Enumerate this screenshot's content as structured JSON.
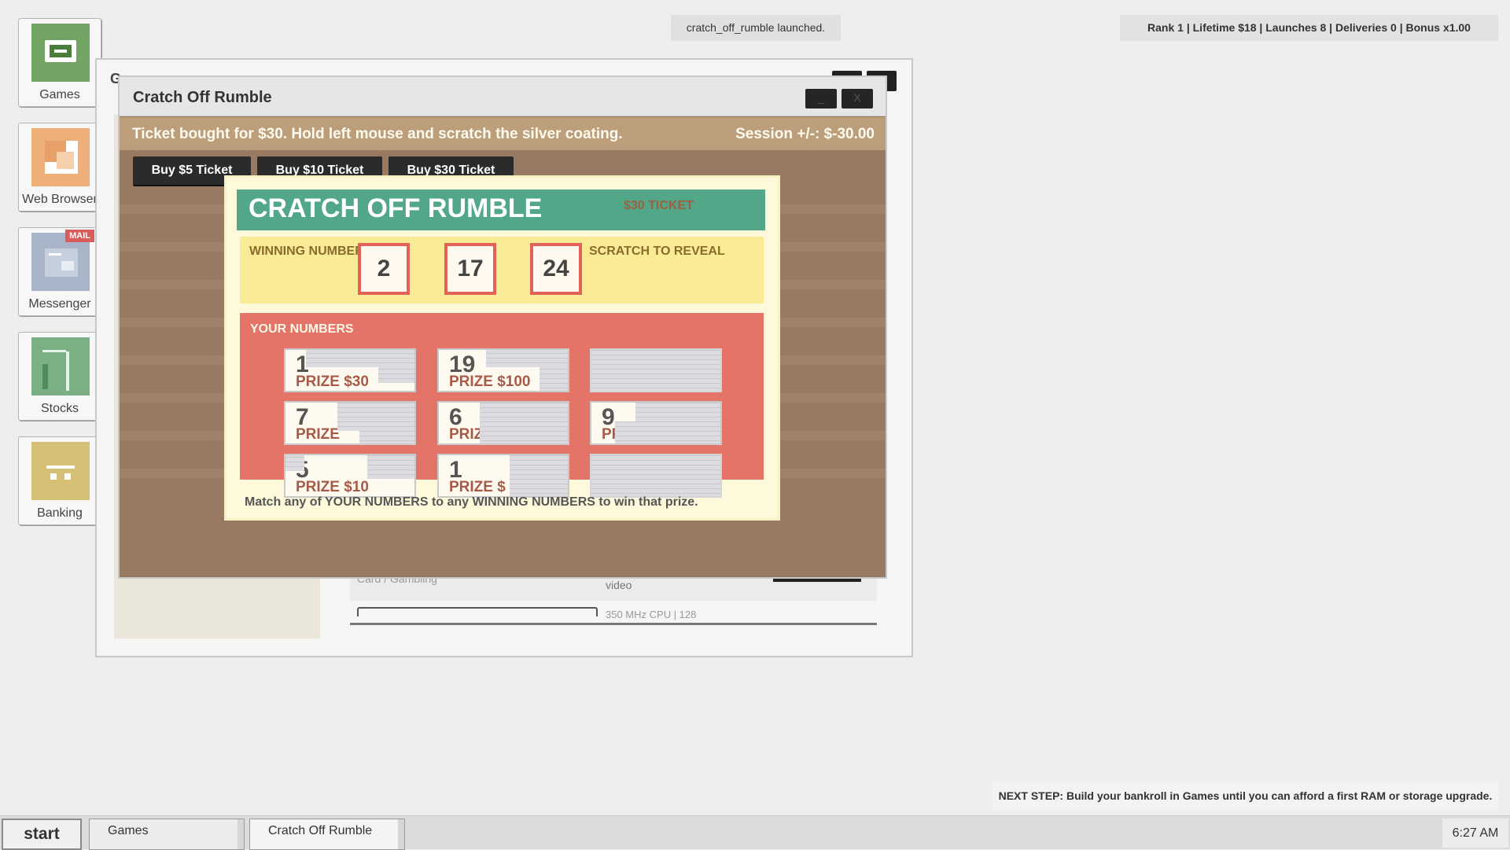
{
  "desktop": {
    "icons": [
      {
        "label": "Games",
        "color": "#72a563",
        "icon": "gamepad-icon"
      },
      {
        "label": "Web Browser",
        "color": "#eeaf78",
        "icon": "browser-icon"
      },
      {
        "label": "Messenger",
        "color": "#a8b5c8",
        "icon": "mail-icon",
        "badge": "MAIL"
      },
      {
        "label": "Stocks",
        "color": "#7ab083",
        "icon": "chart-icon"
      },
      {
        "label": "Banking",
        "color": "#d5c076",
        "icon": "bank-icon"
      }
    ]
  },
  "toast": "cratch_off_rumble launched.",
  "stats": {
    "text": "Rank 1  |  Lifetime $18  |  Launches 8  |  Deliveries 0  |  Bonus x1.00"
  },
  "games_window": {
    "title": "G",
    "row_texts": [
      "Card / Gambling",
      "video",
      "350 MHz CPU | 128"
    ]
  },
  "scratch_window": {
    "title": "Cratch Off Rumble",
    "minimize_label": "_",
    "close_label": "X",
    "message": "Ticket bought for $30. Hold left mouse and scratch the silver coating.",
    "session": "Session +/-: $-30.00",
    "buttons": [
      "Buy $5 Ticket",
      "Buy $10 Ticket",
      "Buy $30 Ticket"
    ]
  },
  "ticket": {
    "name": "CRATCH OFF RUMBLE",
    "price_label": "$30 TICKET",
    "winning_label": "WINNING NUMBERS",
    "scratch_label": "SCRATCH TO REVEAL",
    "winning_numbers": [
      "2",
      "17",
      "24"
    ],
    "your_label": "YOUR NUMBERS",
    "cells": [
      {
        "number": "1",
        "prize": "PRIZE  $30"
      },
      {
        "number": "19",
        "prize": "PRIZE  $100"
      },
      {
        "number": "",
        "prize": ""
      },
      {
        "number": "7",
        "prize": "PRIZE"
      },
      {
        "number": "6",
        "prize": "PRIZE"
      },
      {
        "number": "9",
        "prize": "PRIZE"
      },
      {
        "number": "5",
        "prize": "PRIZE  $10"
      },
      {
        "number": "1",
        "prize": "PRIZE  $"
      },
      {
        "number": "",
        "prize": ""
      }
    ],
    "footer": "Match any of YOUR NUMBERS to any WINNING NUMBERS to win that prize."
  },
  "next_step": "NEXT STEP: Build your bankroll in Games until you can afford a first RAM or storage upgrade.",
  "taskbar": {
    "start": "start",
    "tasks": [
      "Games",
      "Cratch Off Rumble"
    ],
    "clock": "6:27 AM"
  }
}
